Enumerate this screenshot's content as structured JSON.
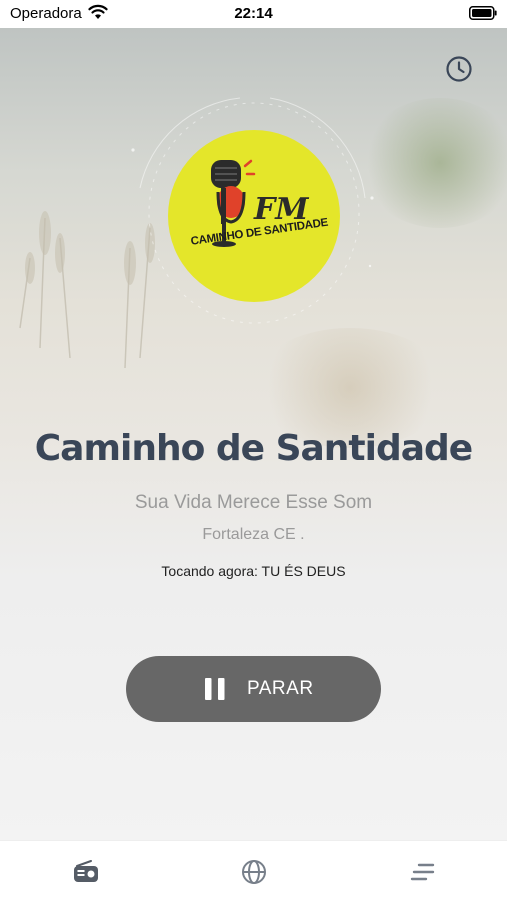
{
  "status_bar": {
    "carrier": "Operadora",
    "time": "22:14",
    "icons": [
      "wifi-icon",
      "battery-icon"
    ]
  },
  "header": {
    "history_icon": "clock-icon"
  },
  "station": {
    "logo_text_top": "FM",
    "logo_text_bottom": "CAMINHO DE SANTIDADE",
    "name": "Caminho de Santidade",
    "slogan": "Sua Vida Merece Esse Som",
    "location": "Fortaleza CE .",
    "now_playing": "Tocando agora: TU ÉS DEUS"
  },
  "player": {
    "stop_label": "PARAR",
    "state": "playing",
    "icon": "pause-icon"
  },
  "tabs": [
    {
      "icon": "radio-icon",
      "active": true
    },
    {
      "icon": "globe-icon",
      "active": false
    },
    {
      "icon": "menu-icon",
      "active": false
    }
  ],
  "colors": {
    "title": "#3a4658",
    "button": "#676767",
    "logo_bg": "#e4e62a",
    "tab_icon": "#555c66"
  }
}
